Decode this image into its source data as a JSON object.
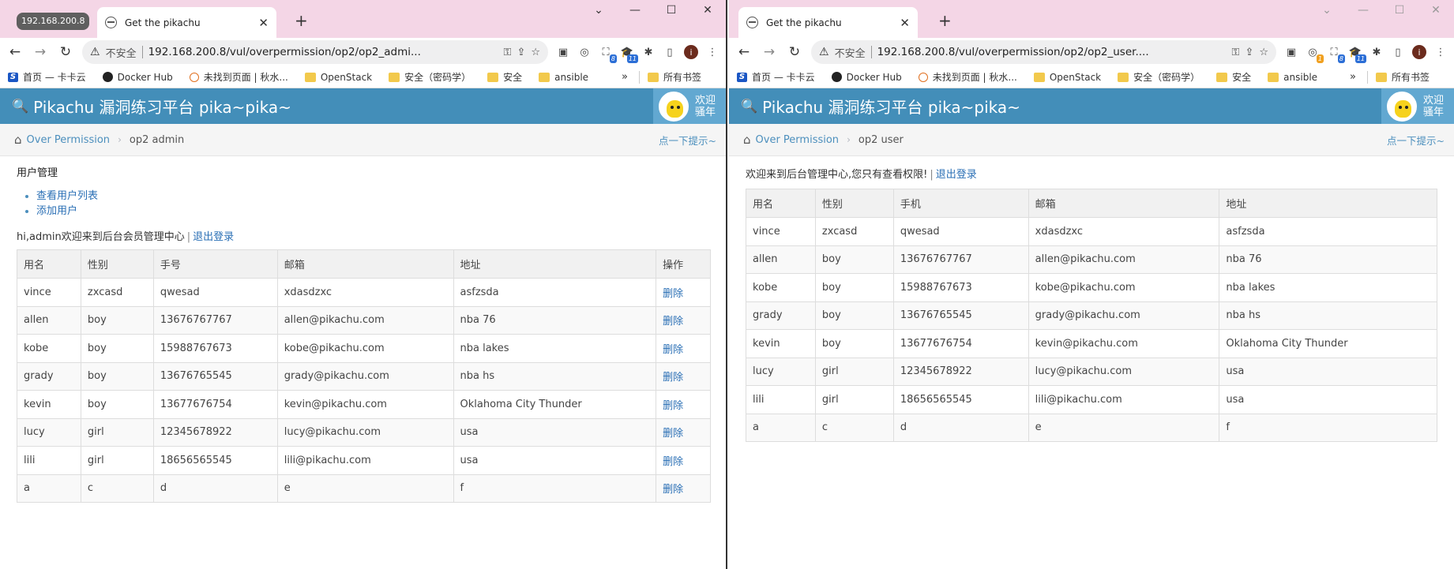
{
  "left": {
    "group_chip": "192.168.200.8",
    "tab_title": "Get the pikachu",
    "url": "192.168.200.8/vul/overpermission/op2/op2_admi...",
    "insecure_label": "不安全",
    "brand": "Pikachu 漏洞练习平台 pika~pika~",
    "welcome": [
      "欢迎",
      "骚年"
    ],
    "breadcrumb": {
      "parent": "Over Permission",
      "current": "op2 admin",
      "hint": "点一下提示~"
    },
    "section_title": "用户管理",
    "menu": [
      "查看用户列表",
      "添加用户"
    ],
    "welcome_text": "hi,admin欢迎来到后台会员管理中心",
    "logout": "退出登录",
    "columns": [
      "用名",
      "性别",
      "手号",
      "邮箱",
      "地址",
      "操作"
    ],
    "rows": [
      [
        "vince",
        "zxcasd",
        "qwesad",
        "xdasdzxc",
        "asfzsda",
        "删除"
      ],
      [
        "allen",
        "boy",
        "13676767767",
        "allen@pikachu.com",
        "nba 76",
        "删除"
      ],
      [
        "kobe",
        "boy",
        "15988767673",
        "kobe@pikachu.com",
        "nba lakes",
        "删除"
      ],
      [
        "grady",
        "boy",
        "13676765545",
        "grady@pikachu.com",
        "nba hs",
        "删除"
      ],
      [
        "kevin",
        "boy",
        "13677676754",
        "kevin@pikachu.com",
        "Oklahoma City Thunder",
        "删除"
      ],
      [
        "lucy",
        "girl",
        "12345678922",
        "lucy@pikachu.com",
        "usa",
        "删除"
      ],
      [
        "lili",
        "girl",
        "18656565545",
        "lili@pikachu.com",
        "usa",
        "删除"
      ],
      [
        "a",
        "c",
        "d",
        "e",
        "f",
        "删除"
      ]
    ]
  },
  "right": {
    "tab_title": "Get the pikachu",
    "url": "192.168.200.8/vul/overpermission/op2/op2_user....",
    "insecure_label": "不安全",
    "brand": "Pikachu 漏洞练习平台 pika~pika~",
    "welcome": [
      "欢迎",
      "骚年"
    ],
    "breadcrumb": {
      "parent": "Over Permission",
      "current": "op2 user",
      "hint": "点一下提示~"
    },
    "welcome_text": "欢迎来到后台管理中心,您只有查看权限!",
    "logout": "退出登录",
    "columns": [
      "用名",
      "性别",
      "手机",
      "邮箱",
      "地址"
    ],
    "rows": [
      [
        "vince",
        "zxcasd",
        "qwesad",
        "xdasdzxc",
        "asfzsda"
      ],
      [
        "allen",
        "boy",
        "13676767767",
        "allen@pikachu.com",
        "nba 76"
      ],
      [
        "kobe",
        "boy",
        "15988767673",
        "kobe@pikachu.com",
        "nba lakes"
      ],
      [
        "grady",
        "boy",
        "13676765545",
        "grady@pikachu.com",
        "nba hs"
      ],
      [
        "kevin",
        "boy",
        "13677676754",
        "kevin@pikachu.com",
        "Oklahoma City Thunder"
      ],
      [
        "lucy",
        "girl",
        "12345678922",
        "lucy@pikachu.com",
        "usa"
      ],
      [
        "lili",
        "girl",
        "18656565545",
        "lili@pikachu.com",
        "usa"
      ],
      [
        "a",
        "c",
        "d",
        "e",
        "f"
      ]
    ]
  },
  "bookmarks": [
    "首页 — 卡卡云",
    "Docker Hub",
    "未找到页面 | 秋水...",
    "OpenStack",
    "安全（密码学）",
    "安全",
    "ansible",
    "所有书签"
  ],
  "bookmark_more": "»",
  "extension_badges": {
    "left": [
      "8",
      "11"
    ],
    "right": [
      "1",
      "8",
      "11"
    ]
  },
  "profile_initial": "i",
  "colors": {
    "navbar": "#438eb9",
    "link": "#2a6fb5",
    "tabbar": "#f4d6e6"
  }
}
